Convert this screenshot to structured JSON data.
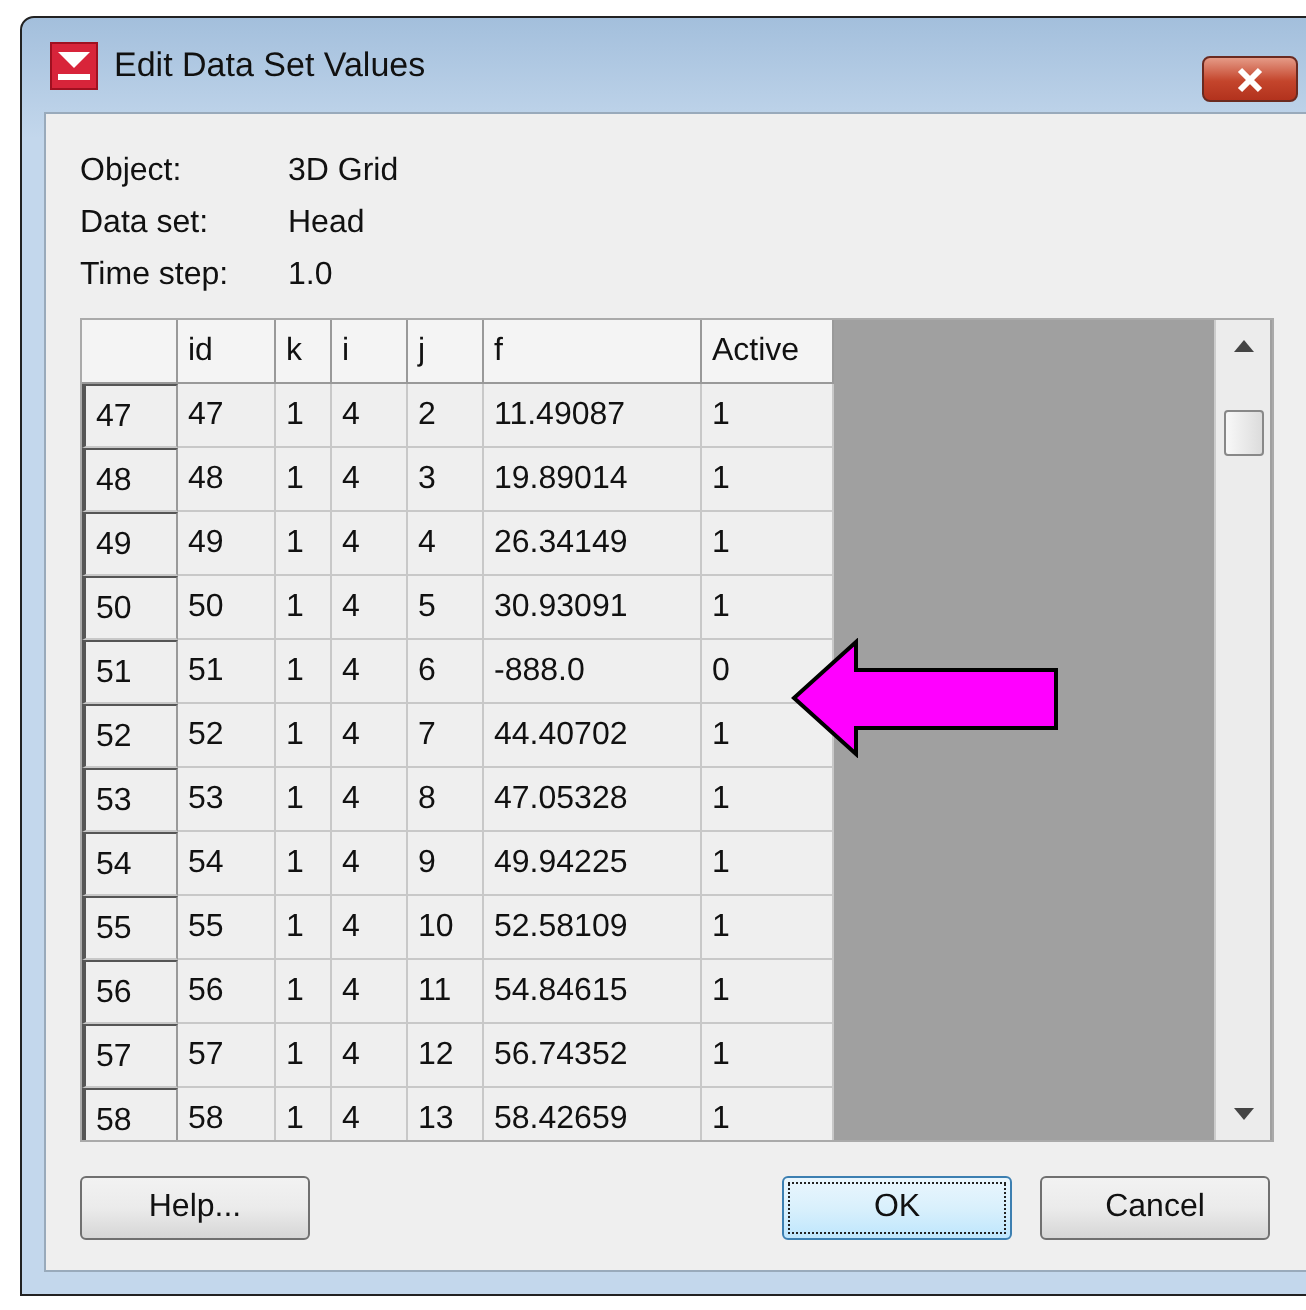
{
  "window": {
    "title": "Edit Data Set Values"
  },
  "info": [
    {
      "label": "Object:",
      "value": "3D Grid"
    },
    {
      "label": "Data set:",
      "value": "Head"
    },
    {
      "label": "Time step:",
      "value": "1.0"
    }
  ],
  "table": {
    "columns": [
      "",
      "id",
      "k",
      "i",
      "j",
      "f",
      "Active"
    ],
    "rows": [
      {
        "cells": [
          "47",
          "47",
          "1",
          "4",
          "2",
          "11.49087",
          "1"
        ]
      },
      {
        "cells": [
          "48",
          "48",
          "1",
          "4",
          "3",
          "19.89014",
          "1"
        ]
      },
      {
        "cells": [
          "49",
          "49",
          "1",
          "4",
          "4",
          "26.34149",
          "1"
        ]
      },
      {
        "cells": [
          "50",
          "50",
          "1",
          "4",
          "5",
          "30.93091",
          "1"
        ]
      },
      {
        "cells": [
          "51",
          "51",
          "1",
          "4",
          "6",
          "-888.0",
          "0"
        ]
      },
      {
        "cells": [
          "52",
          "52",
          "1",
          "4",
          "7",
          "44.40702",
          "1"
        ]
      },
      {
        "cells": [
          "53",
          "53",
          "1",
          "4",
          "8",
          "47.05328",
          "1"
        ]
      },
      {
        "cells": [
          "54",
          "54",
          "1",
          "4",
          "9",
          "49.94225",
          "1"
        ]
      },
      {
        "cells": [
          "55",
          "55",
          "1",
          "4",
          "10",
          "52.58109",
          "1"
        ]
      },
      {
        "cells": [
          "56",
          "56",
          "1",
          "4",
          "11",
          "54.84615",
          "1"
        ]
      },
      {
        "cells": [
          "57",
          "57",
          "1",
          "4",
          "12",
          "56.74352",
          "1"
        ]
      },
      {
        "cells": [
          "58",
          "58",
          "1",
          "4",
          "13",
          "58.42659",
          "1"
        ]
      }
    ]
  },
  "left_buttons": [
    {
      "label": "Help...",
      "focused": false
    }
  ],
  "right_buttons": [
    {
      "label": "OK",
      "focused": true
    },
    {
      "label": "Cancel",
      "focused": false
    }
  ]
}
